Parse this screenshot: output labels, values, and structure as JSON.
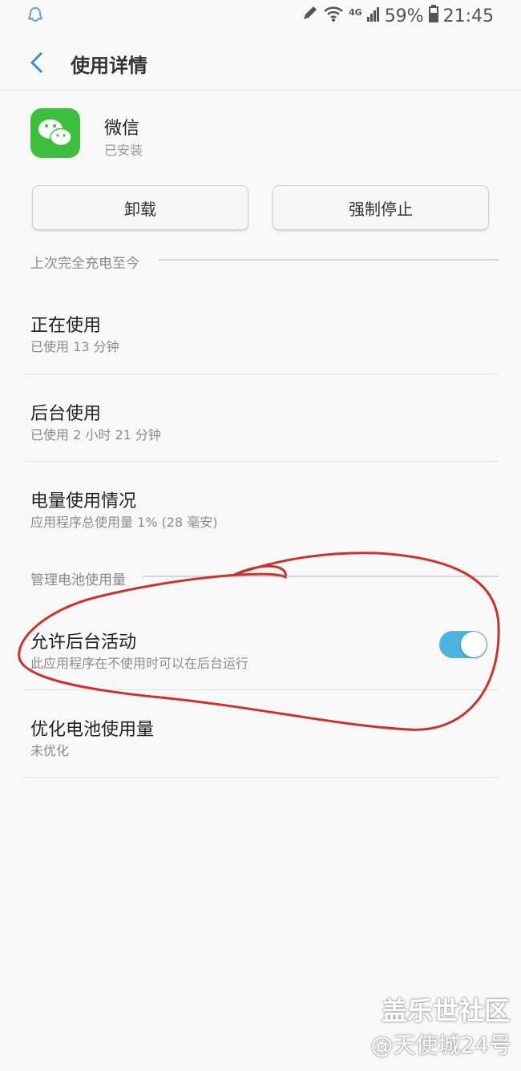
{
  "status_bar": {
    "network": "4G",
    "battery": "59%",
    "time": "21:45"
  },
  "header": {
    "title": "使用详情"
  },
  "app": {
    "name": "微信",
    "status": "已安装"
  },
  "buttons": {
    "uninstall": "卸载",
    "force_stop": "强制停止"
  },
  "sections": {
    "since_full_charge": "上次完全充电至今",
    "manage_battery": "管理电池使用量"
  },
  "items": [
    {
      "title": "正在使用",
      "subtitle": "已使用 13 分钟"
    },
    {
      "title": "后台使用",
      "subtitle": "已使用 2 小时 21 分钟"
    },
    {
      "title": "电量使用情况",
      "subtitle": "应用程序总使用量 1% (28 毫安)"
    },
    {
      "title": "允许后台活动",
      "subtitle": "此应用程序在不使用时可以在后台运行",
      "toggle_on": true
    },
    {
      "title": "优化电池使用量",
      "subtitle": "未优化"
    }
  ],
  "watermark": {
    "line1": "盖乐世社区",
    "line2": "@天使城24号"
  },
  "colors": {
    "accent": "#4fb3e0",
    "app_green": "#3cbf3c",
    "annotation_red": "#c8342c"
  }
}
